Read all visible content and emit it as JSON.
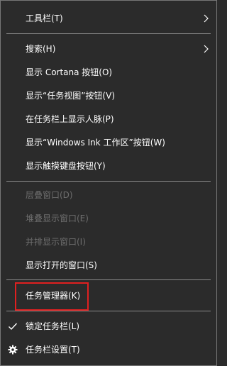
{
  "menu": {
    "toolbars": "工具栏(T)",
    "search": "搜索(H)",
    "show_cortana": "显示 Cortana 按钮(O)",
    "show_task_view": "显示“任务视图”按钮(V)",
    "show_people": "在任务栏上显示人脉(P)",
    "show_ink": "显示“Windows Ink 工作区”按钮(W)",
    "show_touch_keyboard": "显示触摸键盘按钮(Y)",
    "cascade": "层叠窗口(D)",
    "stacked": "堆叠显示窗口(E)",
    "side_by_side": "并排显示窗口(I)",
    "show_open_windows": "显示打开的窗口(S)",
    "task_manager": "任务管理器(K)",
    "lock_taskbar": "锁定任务栏(L)",
    "taskbar_settings": "任务栏设置(T)"
  },
  "icons": {
    "submenu": "chevron-right-icon",
    "check": "checkmark-icon",
    "settings": "gear-icon"
  },
  "colors": {
    "background": "#2b2b2b",
    "text": "#ffffff",
    "disabled_text": "#6d6d6d",
    "separator": "#8a8a8a",
    "highlight": "#e02020"
  },
  "state": {
    "lock_taskbar_checked": true,
    "highlighted_item": "task_manager"
  }
}
